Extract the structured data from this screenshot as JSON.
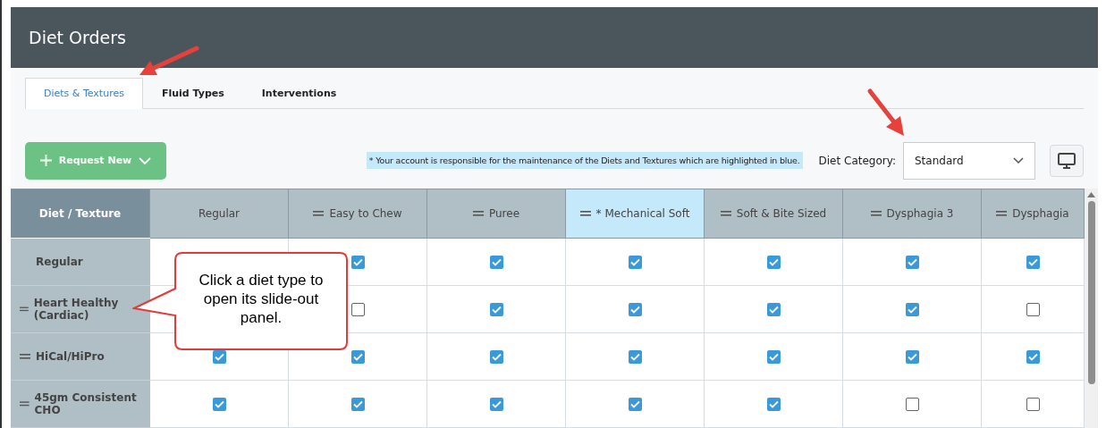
{
  "header": {
    "title": "Diet Orders"
  },
  "tabs": [
    {
      "label": "Diets & Textures",
      "selected": true
    },
    {
      "label": "Fluid Types",
      "selected": false
    },
    {
      "label": "Interventions",
      "selected": false
    }
  ],
  "toolbar": {
    "request_button": "Request New",
    "notice": "* Your account is responsible for the maintenance of the Diets and Textures which are highlighted in blue.",
    "category_label": "Diet Category:",
    "category_value": "Standard"
  },
  "table": {
    "corner": "Diet / Texture",
    "columns": [
      {
        "label": "Regular",
        "draggable": false,
        "highlighted": false
      },
      {
        "label": "Easy to Chew",
        "draggable": true,
        "highlighted": false
      },
      {
        "label": "Puree",
        "draggable": true,
        "highlighted": false
      },
      {
        "label": "* Mechanical Soft",
        "draggable": true,
        "highlighted": true
      },
      {
        "label": "Soft & Bite Sized",
        "draggable": true,
        "highlighted": false
      },
      {
        "label": "Dysphagia 3",
        "draggable": true,
        "highlighted": false
      },
      {
        "label": "Dysphagia",
        "draggable": true,
        "highlighted": false
      }
    ],
    "rows": [
      {
        "label": "Regular",
        "draggable": false,
        "cells": [
          null,
          {
            "checked": true
          },
          {
            "checked": true
          },
          {
            "checked": true
          },
          {
            "checked": true
          },
          {
            "checked": true
          },
          {
            "checked": true
          }
        ]
      },
      {
        "label": "Heart Healthy (Cardiac)",
        "draggable": true,
        "cells": [
          null,
          {
            "checked": false
          },
          {
            "checked": true
          },
          {
            "checked": true
          },
          {
            "checked": true
          },
          {
            "checked": true
          },
          {
            "checked": false
          }
        ]
      },
      {
        "label": "HiCal/HiPro",
        "draggable": true,
        "cells": [
          {
            "checked": true
          },
          {
            "checked": true
          },
          {
            "checked": true
          },
          {
            "checked": true
          },
          {
            "checked": true
          },
          {
            "checked": true
          },
          {
            "checked": true
          }
        ]
      },
      {
        "label": "45gm Consistent CHO",
        "draggable": true,
        "cells": [
          {
            "checked": true
          },
          {
            "checked": true
          },
          {
            "checked": true
          },
          {
            "checked": true
          },
          {
            "checked": true
          },
          {
            "checked": false
          },
          {
            "checked": false
          }
        ]
      }
    ]
  },
  "callout": {
    "text": "Click a diet type to open its slide-out panel."
  }
}
